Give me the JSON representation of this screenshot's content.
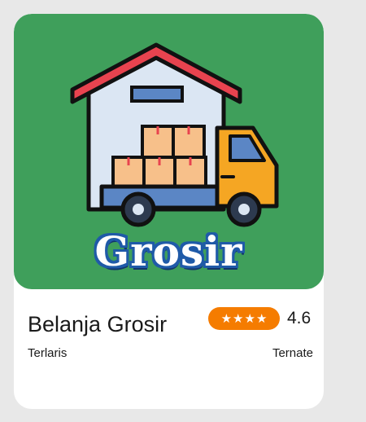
{
  "card": {
    "logo_text": "Grosir",
    "title": "Belanja Grosir",
    "rating": {
      "stars": 4,
      "value": "4.6",
      "pill_color": "#f57c00"
    },
    "subtitle": "Terlaris",
    "location": "Ternate"
  },
  "colors": {
    "banner": "#3f9f5b",
    "roof": "#e8434f",
    "truck": "#f5a623"
  }
}
